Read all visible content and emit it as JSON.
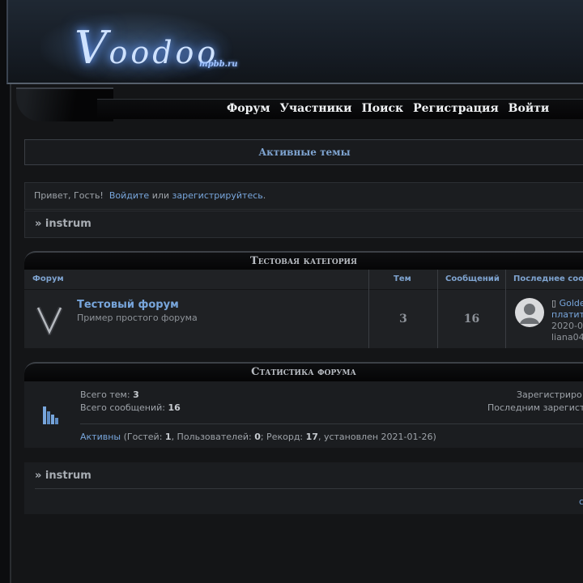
{
  "header": {
    "logo_big": "V",
    "logo_rest": "oodoo",
    "logo_sub": "mpbb.ru"
  },
  "nav": [
    "Форум",
    "Участники",
    "Поиск",
    "Регистрация",
    "Войти"
  ],
  "active_topics": "Активные темы",
  "greeting": {
    "prefix": "Привет, Гость!",
    "login": "Войдите",
    "or": "или",
    "register": "зарегистрируйтесь",
    "end": "."
  },
  "crumb": "» instrum",
  "category": {
    "title": "Тестовая категория",
    "columns": {
      "forum": "Форум",
      "topics": "Тем",
      "posts": "Сообщений",
      "last": "Последнее соо"
    },
    "forum": {
      "title": "Тестовый форум",
      "desc": "Пример простого форума",
      "topics": "3",
      "posts": "16",
      "last_topic": "Golde",
      "last_topic_line2": "платит",
      "last_date": "2020-0",
      "last_user": "liana04"
    }
  },
  "stats": {
    "title": "Статистика форума",
    "topics_label": "Всего тем:",
    "topics_value": "3",
    "posts_label": "Всего сообщений:",
    "posts_value": "16",
    "registered": "Зарегистриро",
    "last_registered": "Последним зарегист",
    "online_link": "Активны",
    "online_open": "(Гостей:",
    "guests": "1",
    "users_label": ", Пользователей:",
    "users": "0",
    "record_label": "; Рекорд:",
    "record": "17",
    "set_label": ", установлен 2021-01-26)"
  },
  "bottom_crumb": "» instrum",
  "bottom_link": "c",
  "colors": {
    "link": "#78a6dc",
    "bg": "#0c0d0f",
    "panel": "#1b1d20"
  }
}
